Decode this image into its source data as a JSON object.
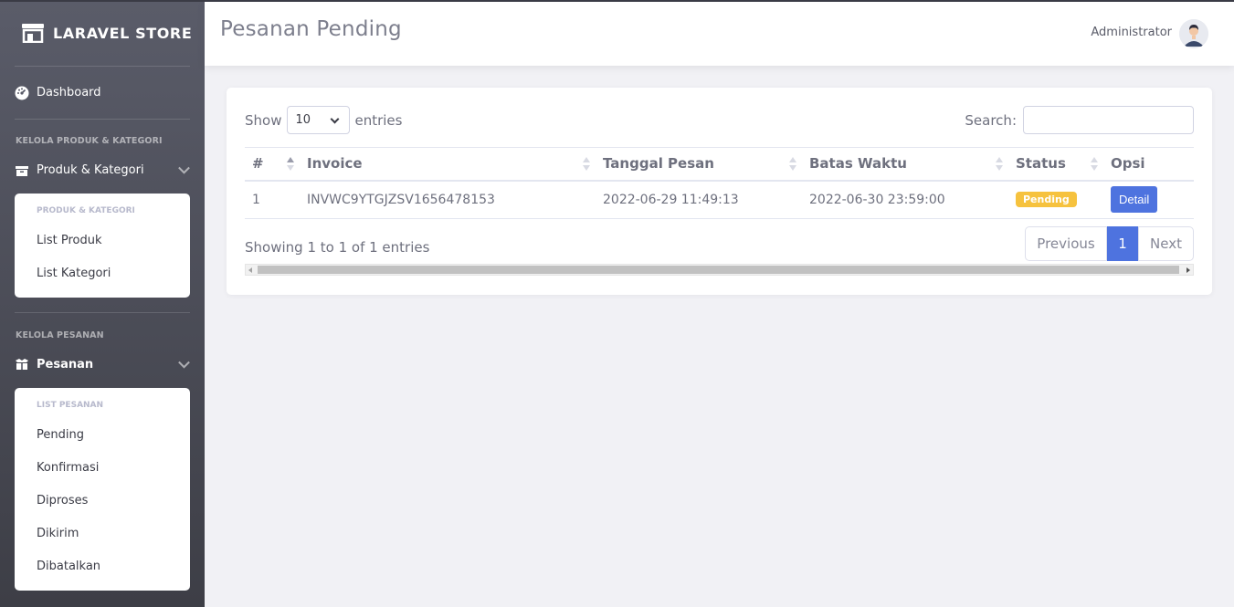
{
  "brand": {
    "name": "LARAVEL STORE",
    "icon": "store-icon"
  },
  "sidebar": {
    "dashboard": {
      "label": "Dashboard",
      "icon": "tachometer-icon"
    },
    "sections": [
      {
        "heading": "KELOLA PRODUK & KATEGORI",
        "menu": {
          "label": "Produk & Kategori",
          "icon": "boxes-icon",
          "expanded": true
        },
        "submenu": {
          "heading": "PRODUK & KATEGORI",
          "items": [
            "List Produk",
            "List Kategori"
          ]
        }
      },
      {
        "heading": "KELOLA PESANAN",
        "menu": {
          "label": "Pesanan",
          "icon": "box-open-icon",
          "expanded": true
        },
        "submenu": {
          "heading": "LIST PESANAN",
          "items": [
            "Pending",
            "Konfirmasi",
            "Diproses",
            "Dikirim",
            "Dibatalkan"
          ]
        }
      }
    ]
  },
  "topbar": {
    "title": "Pesanan Pending",
    "user": "Administrator",
    "avatar_icon": "user-avatar-icon"
  },
  "table_controls": {
    "show_label": "Show",
    "entries_value": "10",
    "entries_label": "entries",
    "search_label": "Search:",
    "search_value": ""
  },
  "table": {
    "columns": [
      "#",
      "Invoice",
      "Tanggal Pesan",
      "Batas Waktu",
      "Status",
      "Opsi"
    ],
    "rows": [
      {
        "no": "1",
        "invoice": "INVWC9YTGJZSV1656478153",
        "tanggal": "2022-06-29 11:49:13",
        "batas": "2022-06-30 23:59:00",
        "status": "Pending",
        "action": "Detail"
      }
    ]
  },
  "footer": {
    "info": "Showing 1 to 1 of 1 entries",
    "prev": "Previous",
    "page": "1",
    "next": "Next"
  },
  "colors": {
    "primary": "#4e73df",
    "warning": "#f6c23e",
    "sidebar": "#5a5c69"
  }
}
